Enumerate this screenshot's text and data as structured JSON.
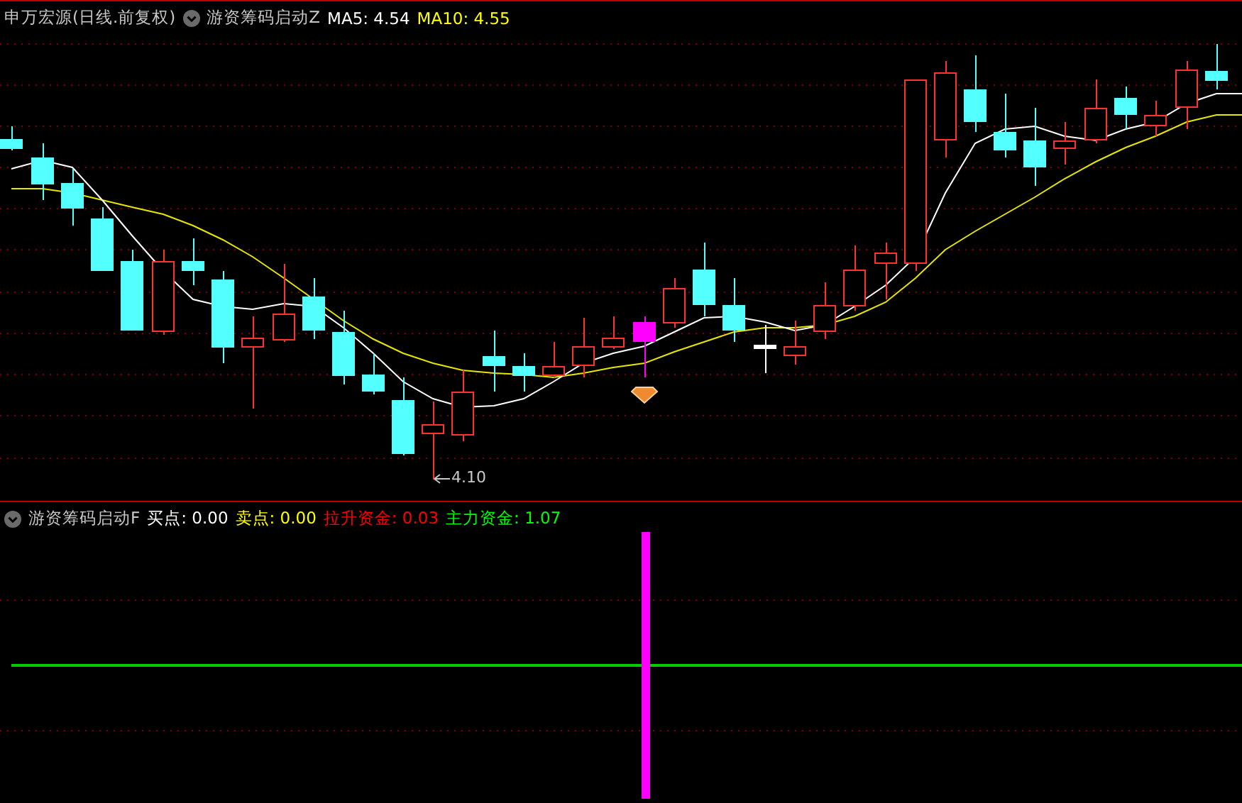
{
  "main_panel": {
    "title": "申万宏源(日线.前复权)",
    "indicator": "游资筹码启动Z",
    "legend": [
      {
        "text": "MA5: 4.54",
        "color": "#ffffff"
      },
      {
        "text": "MA10: 4.55",
        "color": "#ffff00"
      }
    ],
    "low_label": "4.10"
  },
  "sub_panel": {
    "indicator": "游资筹码启动F",
    "legend": [
      {
        "text": "买点: 0.00",
        "color": "#ffffff"
      },
      {
        "text": "卖点: 0.00",
        "color": "#ffff00"
      },
      {
        "text": "拉升资金: 0.03",
        "color": "#ff0000"
      },
      {
        "text": "主力资金: 1.07",
        "color": "#00ff00"
      }
    ]
  }
}
